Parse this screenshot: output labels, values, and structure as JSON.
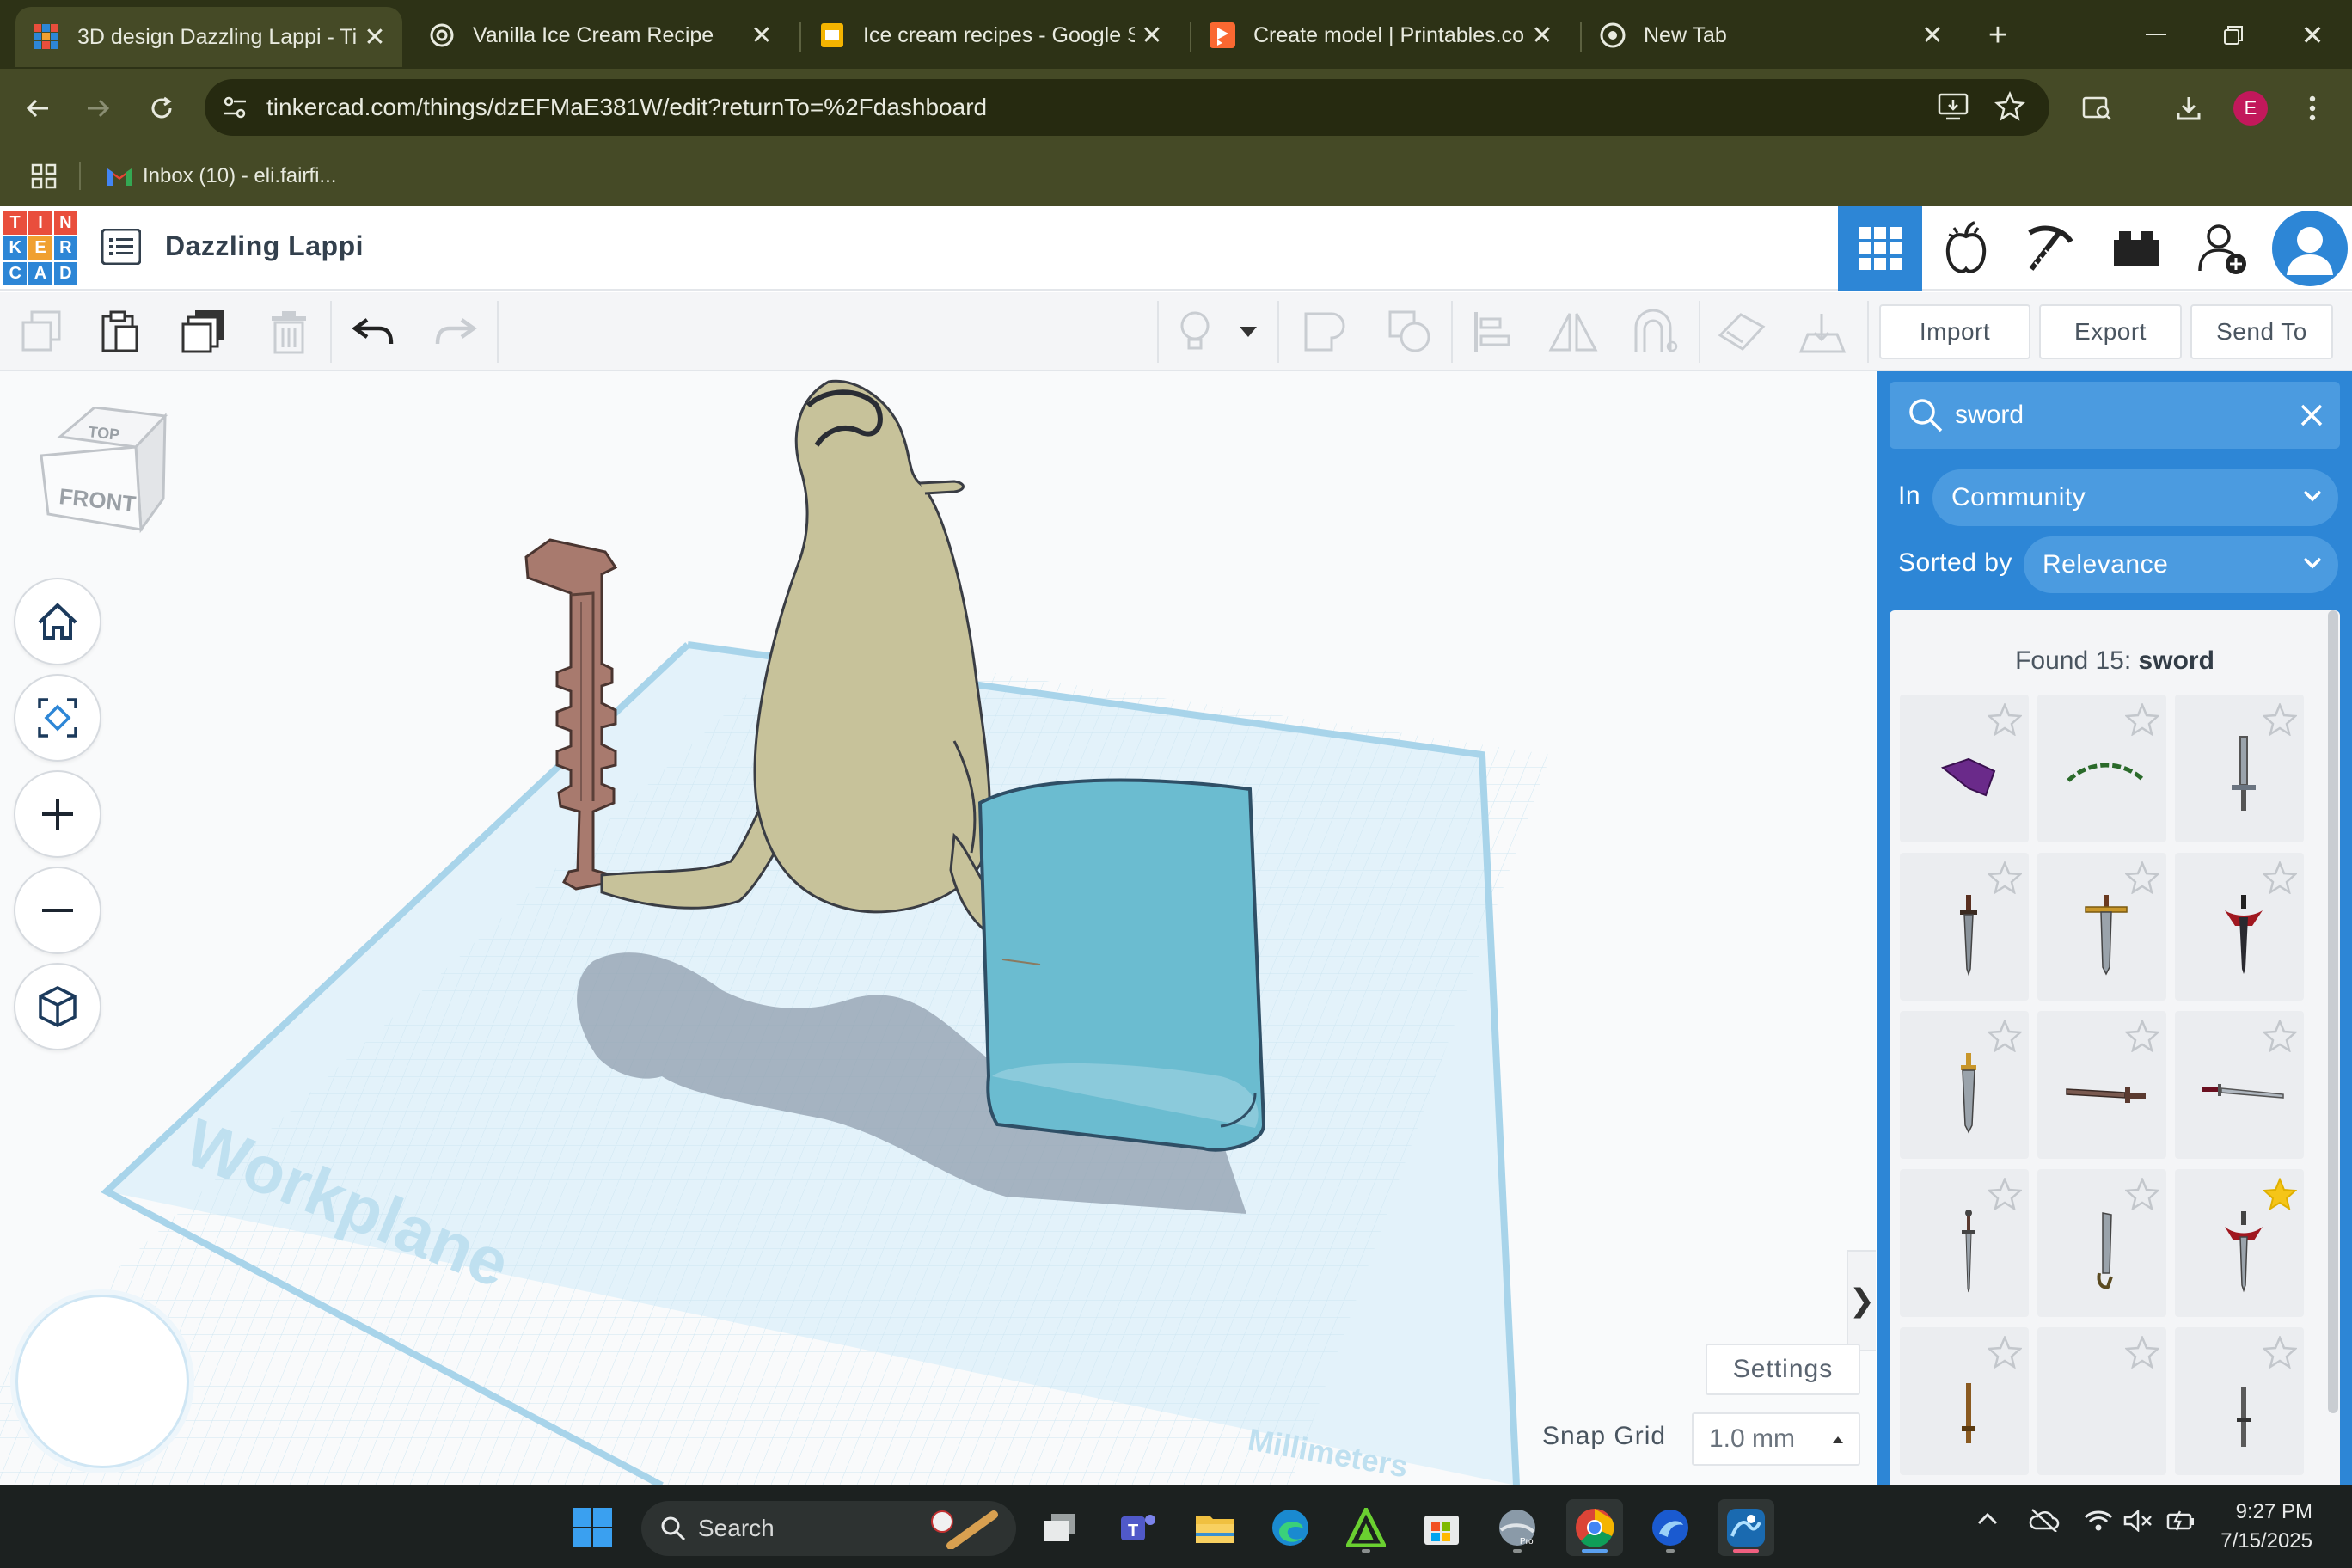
{
  "browser": {
    "tabs": [
      {
        "title": "3D design Dazzling Lappi - Ti",
        "favicon": "tinkercad-icon",
        "active": true
      },
      {
        "title": "Vanilla Ice Cream Recipe",
        "favicon": "openai-icon",
        "active": false
      },
      {
        "title": "Ice cream recipes - Google Sl",
        "favicon": "google-slides-icon",
        "active": false
      },
      {
        "title": "Create model | Printables.com",
        "favicon": "printables-icon",
        "active": false
      },
      {
        "title": "New Tab",
        "favicon": "chrome-icon",
        "active": false
      }
    ],
    "new_tab_label": "+",
    "url": "tinkercad.com/things/dzEFMaE381W/edit?returnTo=%2Fdashboard",
    "profile_initial": "E",
    "bookmark_gmail": "Inbox (10) - eli.fairfi..."
  },
  "app": {
    "logo_letters": [
      "T",
      "I",
      "N",
      "K",
      "E",
      "R",
      "C",
      "A",
      "D"
    ],
    "design_title": "Dazzling Lappi",
    "header_buttons": [
      "3d-view-grid",
      "sim-lab",
      "build-pickaxe",
      "bricks",
      "invite-user",
      "account"
    ]
  },
  "toolbar": {
    "import_label": "Import",
    "export_label": "Export",
    "send_to_label": "Send To"
  },
  "viewport": {
    "view_cube_top": "TOP",
    "view_cube_front": "FRONT",
    "workplane_label": "Workplane",
    "units_label": "Millimeters",
    "settings_label": "Settings",
    "snap_grid_label": "Snap Grid",
    "snap_grid_value": "1.0 mm",
    "collapse_label": "❯"
  },
  "panel": {
    "search_query": "sword",
    "in_label": "In",
    "in_value": "Community",
    "sorted_label": "Sorted by",
    "sorted_value": "Relevance",
    "found_prefix": "Found 15:",
    "found_term": "sword",
    "results": [
      {
        "shape": "purple-gem",
        "starred": false
      },
      {
        "shape": "green-arc",
        "starred": false
      },
      {
        "shape": "gray-sword",
        "starred": false
      },
      {
        "shape": "dagger-brown",
        "starred": false
      },
      {
        "shape": "gold-hilt-sword",
        "starred": false
      },
      {
        "shape": "red-dagger",
        "starred": false
      },
      {
        "shape": "gold-dagger",
        "starred": false
      },
      {
        "shape": "horizontal-brown-sword",
        "starred": false
      },
      {
        "shape": "horizontal-silver-sword",
        "starred": false
      },
      {
        "shape": "thin-sword",
        "starred": false
      },
      {
        "shape": "curved-sword",
        "starred": false
      },
      {
        "shape": "red-guard-dagger",
        "starred": true
      },
      {
        "shape": "bronze-sword",
        "starred": false
      },
      {
        "shape": "empty",
        "starred": false
      },
      {
        "shape": "dark-sword",
        "starred": false
      }
    ]
  },
  "taskbar": {
    "search_label": "Search",
    "time": "9:27 PM",
    "date": "7/15/2025"
  },
  "colors": {
    "chrome_bg": "#2d3216",
    "chrome_toolbar": "#454a26",
    "tinkercad_blue": "#2d86d6",
    "workplane_grid": "#bfe0f0",
    "shape_body": "#c7c29a",
    "shape_sword": "#a87a6e",
    "shape_cylinder": "#6bbcd0",
    "star_active": "#f5c518"
  }
}
